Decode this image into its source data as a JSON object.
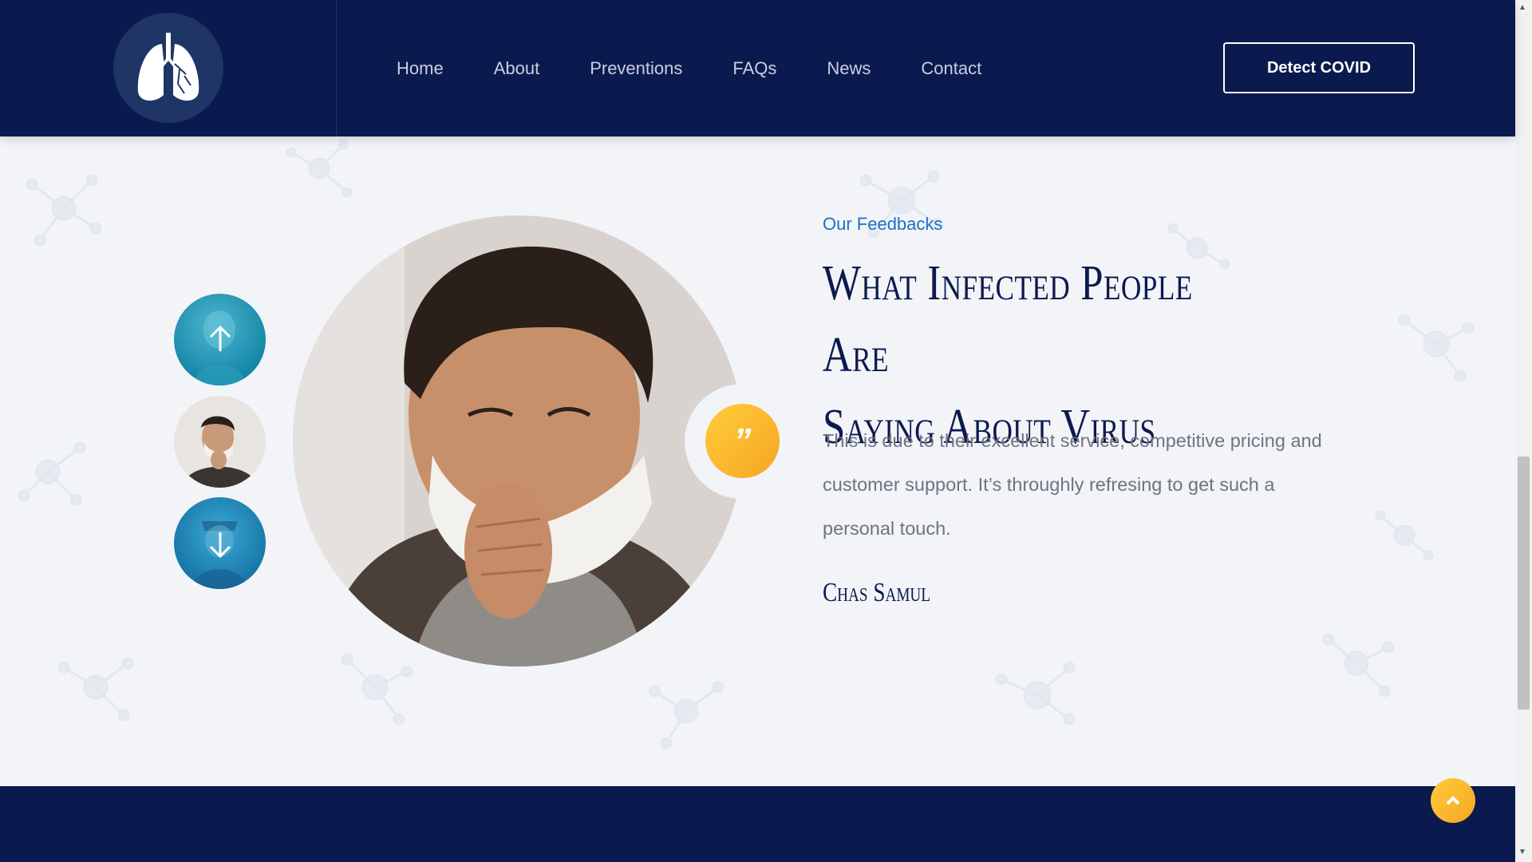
{
  "nav": {
    "items": [
      {
        "label": "Home"
      },
      {
        "label": "About"
      },
      {
        "label": "Preventions"
      },
      {
        "label": "FAQs"
      },
      {
        "label": "News"
      },
      {
        "label": "Contact"
      }
    ],
    "cta_label": "Detect COVID"
  },
  "feedback": {
    "eyebrow": "Our Feedbacks",
    "title_line1": "What Infected People Are",
    "title_line2": "Saying About Virus",
    "quote_glyph": "”",
    "text": "This is due to their excellent service, competitive pricing and customer support. It’s throughly refresing to get such a personal touch.",
    "author": "Chas Samul"
  },
  "icons": {
    "logo": "lungs-icon",
    "slider_up": "arrow-up-icon",
    "slider_down": "arrow-down-icon",
    "quote": "quote-icon",
    "to_top": "chevron-up-icon"
  },
  "colors": {
    "navy": "#0b1a4e",
    "accent_blue": "#1c6fc6",
    "accent_orange": "#f6a623",
    "background": "#f2f4f8",
    "body_text": "#6f7382"
  }
}
